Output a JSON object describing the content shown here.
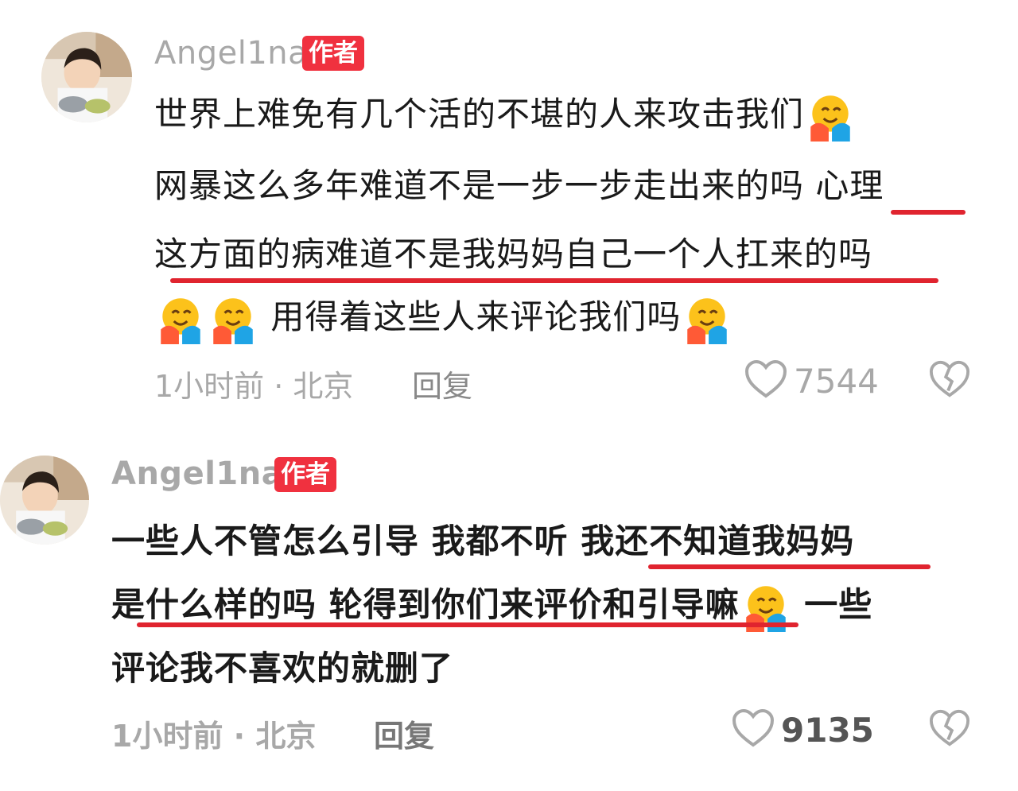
{
  "comments": [
    {
      "username": "Angel1na",
      "badge": "作者",
      "lines": [
        "世界上难免有几个活的不堪的人来攻击我们",
        "网暴这么多年难道不是一步一步走出来的吗 心理",
        "这方面的病难道不是我妈妈自己一个人扛来的吗",
        "用得着这些人来评论我们吗"
      ],
      "meta": "1小时前 · 北京",
      "reply": "回复",
      "likes": "7544",
      "emoji": "hugging-face-emoji"
    },
    {
      "username": "Angel1na",
      "badge": "作者",
      "lines": [
        "一些人不管怎么引导 我都不听 我还不知道我妈妈",
        "是什么样的吗 轮得到你们来评价和引导嘛",
        "一些",
        "评论我不喜欢的就删了"
      ],
      "meta": "1小时前 · 北京",
      "reply": "回复",
      "likes": "9135",
      "emoji": "hugging-face-emoji"
    }
  ],
  "icons": {
    "like": "heart-outline-icon",
    "dislike": "broken-heart-icon"
  },
  "colors": {
    "badge": "#f0313f",
    "underline": "#e0242f",
    "muted": "#a8a8a8"
  }
}
